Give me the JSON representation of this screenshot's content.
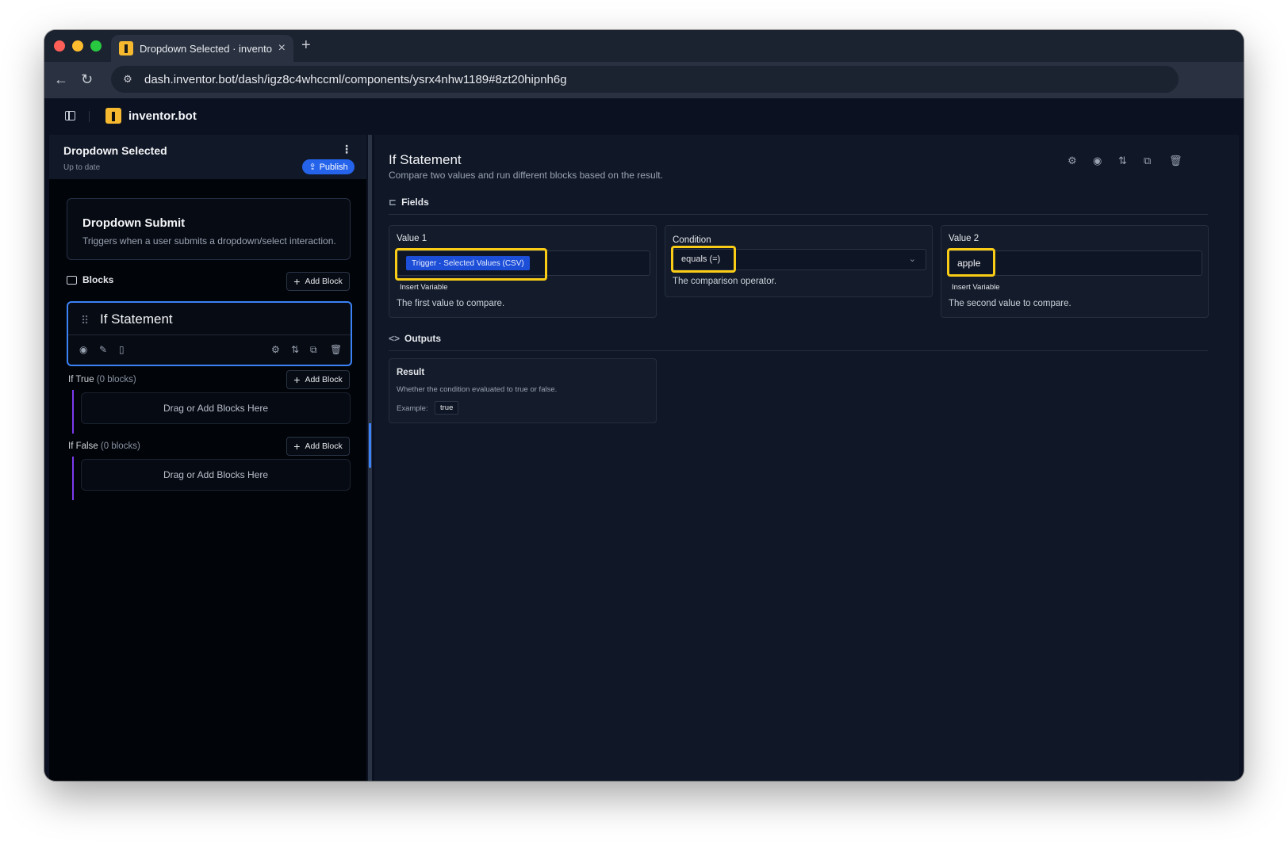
{
  "browser": {
    "tab_title": "Dropdown Selected · inventor.bot",
    "url": "dash.inventor.bot/dash/igz8c4whccml/components/ysrx4nhw1189#8zt20hipnh6g"
  },
  "app": {
    "brand": "inventor.bot"
  },
  "workflow": {
    "title": "Dropdown Selected",
    "status": "Up to date",
    "publish_label": "Publish"
  },
  "trigger": {
    "title": "Dropdown Submit",
    "description": "Triggers when a user submits a dropdown/select interaction."
  },
  "blocks": {
    "label": "Blocks",
    "add_label": "Add Block",
    "selected_block_title": "If Statement",
    "if_true": {
      "label": "If True",
      "count": "(0 blocks)",
      "add_label": "Add Block",
      "placeholder": "Drag or Add Blocks Here"
    },
    "if_false": {
      "label": "If False",
      "count": "(0 blocks)",
      "add_label": "Add Block",
      "placeholder": "Drag or Add Blocks Here"
    }
  },
  "detail": {
    "title": "If Statement",
    "description": "Compare two values and run different blocks based on the result.",
    "fields_heading": "Fields",
    "value1": {
      "label": "Value 1",
      "variable_chip": "Trigger · Selected Values (CSV)",
      "insert_variable": "Insert Variable",
      "help": "The first value to compare."
    },
    "condition": {
      "label": "Condition",
      "selected": "equals (=)",
      "help": "The comparison operator."
    },
    "value2": {
      "label": "Value 2",
      "value": "apple",
      "insert_variable": "Insert Variable",
      "help": "The second value to compare."
    },
    "outputs_heading": "Outputs",
    "output": {
      "title": "Result",
      "description": "Whether the condition evaluated to true or false.",
      "example_label": "Example:",
      "example_value": "true"
    }
  },
  "colors": {
    "accent": "#3b82f6",
    "highlight": "#facc15",
    "brand": "#f5b82e",
    "branch_line": "#7c3aed"
  }
}
